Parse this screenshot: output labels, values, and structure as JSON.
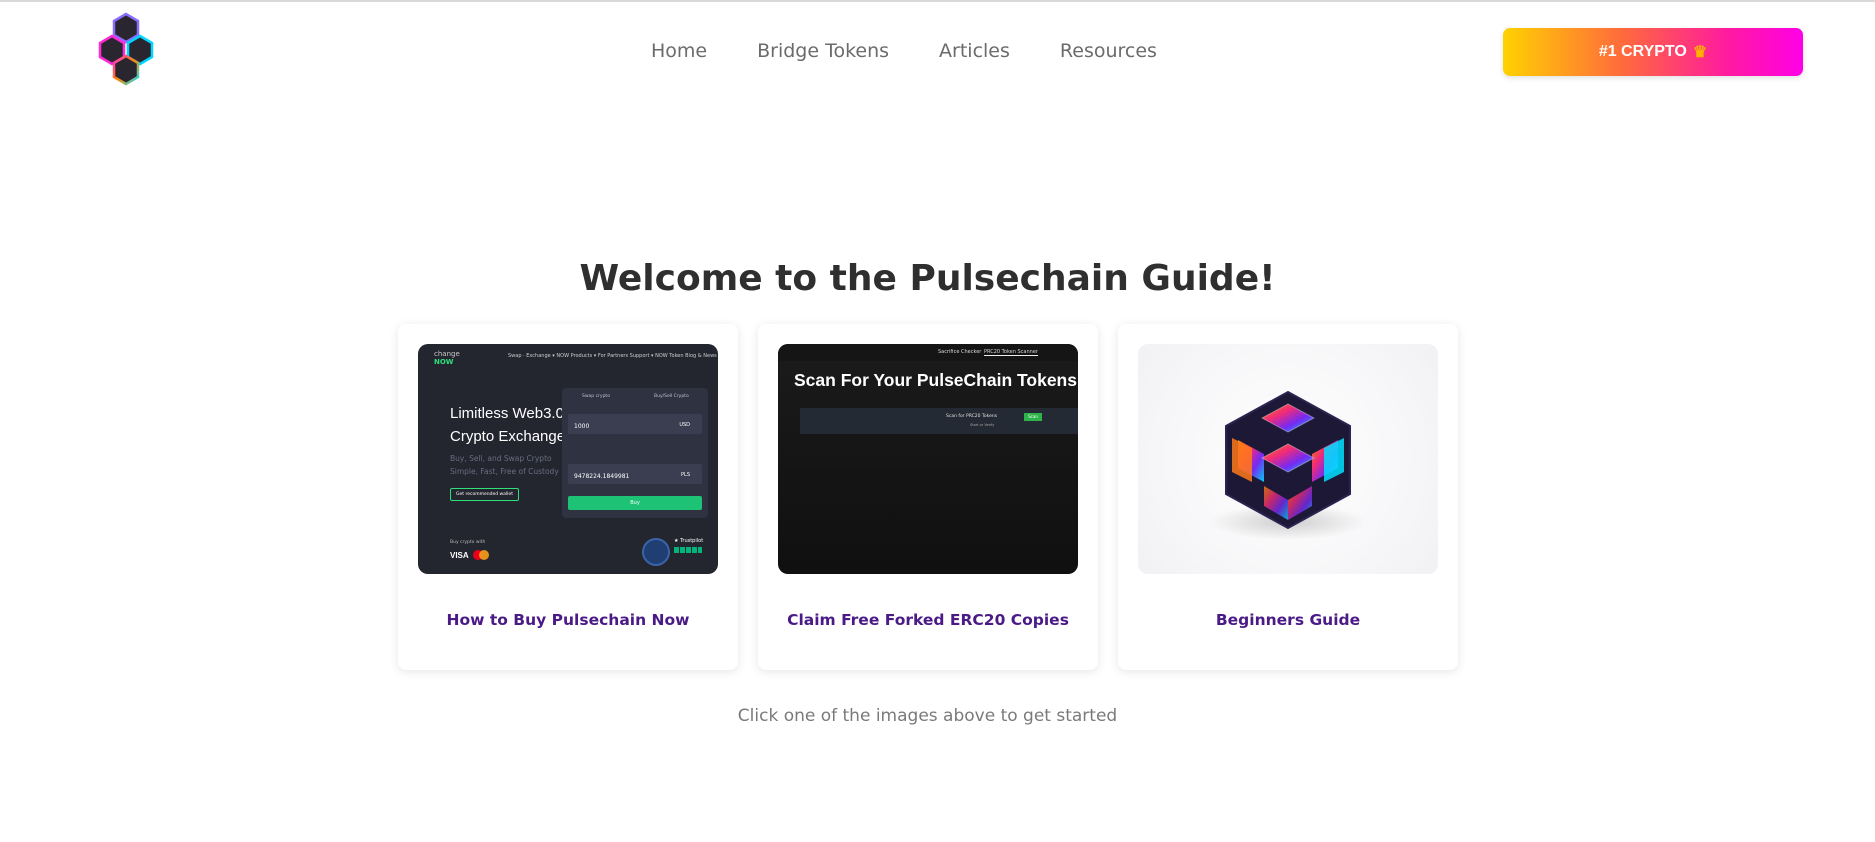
{
  "header": {
    "logo_icon": "hexagon-cluster-logo-icon",
    "nav": [
      "Home",
      "Bridge Tokens",
      "Articles",
      "Resources"
    ],
    "cta_label": "#1 CRYPTO",
    "cta_icon": "crown-icon",
    "cta_glyph": "♛"
  },
  "hero": {
    "title": "Welcome to the Pulsechain Guide!",
    "hint": "Click one of the images above to get started"
  },
  "cards": [
    {
      "label": "How to Buy Pulsechain Now",
      "thumb": {
        "brand_top": "change",
        "brand_bottom": "NOW",
        "nav_text": "Swap · Exchange ▾  NOW Products ▾  For Partners  Support ▾  NOW Token  Blog & News",
        "heading_line1": "Limitless Web3.0",
        "heading_line2": "Crypto Exchange",
        "sub_line1": "Buy, Sell, and Swap Crypto",
        "sub_line2": "Simple, Fast, Free of Custody",
        "recommended": "Get recommended wallet",
        "tab_left": "Swap crypto",
        "tab_right": "Buy/Sell Crypto",
        "send_value": "1000",
        "send_currency": "USD",
        "get_value": "9478224.1849981",
        "get_currency": "PLS",
        "buy_button": "Buy",
        "pay_label": "Buy crypto with",
        "visa": "VISA",
        "trustpilot": "★ Trustpilot"
      }
    },
    {
      "label": "Claim Free Forked ERC20 Copies",
      "thumb": {
        "tab1": "Sacrifice Checker",
        "tab2": "PRC20 Token Scanner",
        "title": "Scan For Your PulseChain Tokens",
        "bar_label": "Scan for PRC20 Tokens",
        "bar_button": "Scan",
        "bar_small": "Start or Verify"
      }
    },
    {
      "label": "Beginners Guide",
      "thumb": {
        "icon": "glowing-hexagon-cube-icon"
      }
    }
  ]
}
